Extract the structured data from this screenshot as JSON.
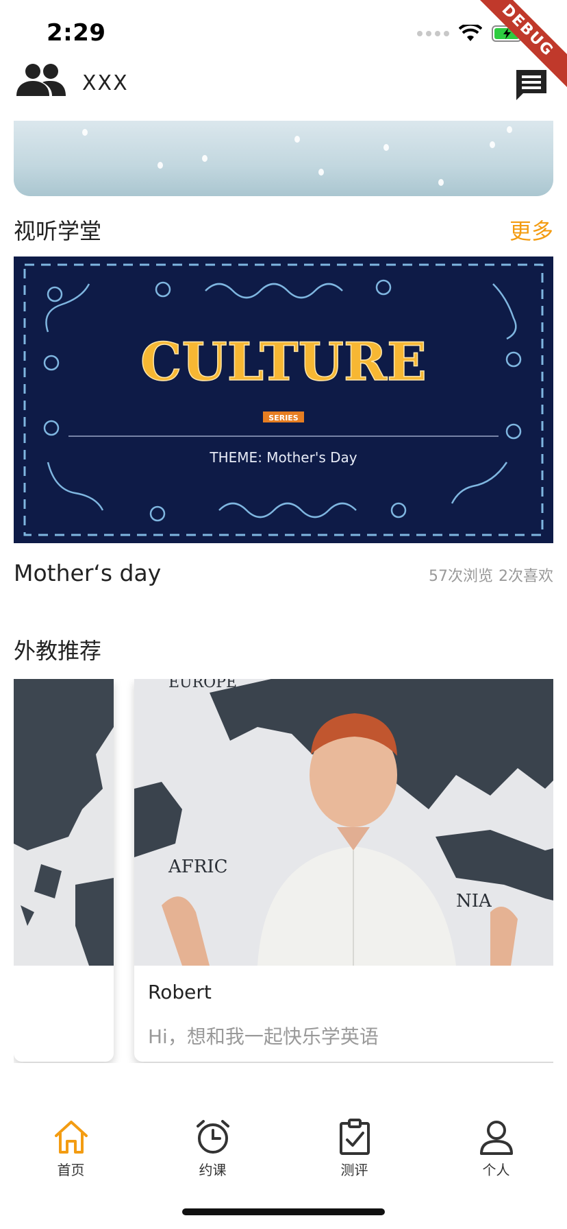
{
  "status_bar": {
    "time": "2:29",
    "debug_label": "DEBUG",
    "icons": [
      "signal-icon",
      "wifi-icon",
      "battery-charging-icon"
    ]
  },
  "header": {
    "title": "XXX",
    "left_icon": "people-icon",
    "right_icon": "message-icon"
  },
  "listening_section": {
    "title": "视听学堂",
    "more_label": "更多",
    "video": {
      "thumbnail_heading": "CULTURE",
      "thumbnail_tag": "SERIES",
      "thumbnail_theme": "THEME:  Mother's Day",
      "title": "Mother‘s day",
      "views": "57次浏览",
      "likes": "2次喜欢"
    }
  },
  "teachers_section": {
    "title": "外教推荐",
    "cards": [
      {
        "name": "Robert",
        "greeting": "Hi，想和我一起快乐学英语",
        "map_labels": [
          "EUROPE",
          "AFRIC",
          "NIA"
        ]
      }
    ]
  },
  "bottom_nav": {
    "items": [
      {
        "label": "首页",
        "icon": "home-icon",
        "active": true
      },
      {
        "label": "约课",
        "icon": "alarm-clock-icon",
        "active": false
      },
      {
        "label": "测评",
        "icon": "clipboard-check-icon",
        "active": false
      },
      {
        "label": "个人",
        "icon": "person-icon",
        "active": false
      }
    ]
  },
  "colors": {
    "accent": "#f39c12",
    "thumbnail_bg": "#0e1b47",
    "text_primary": "#222222",
    "text_secondary": "#999999"
  }
}
